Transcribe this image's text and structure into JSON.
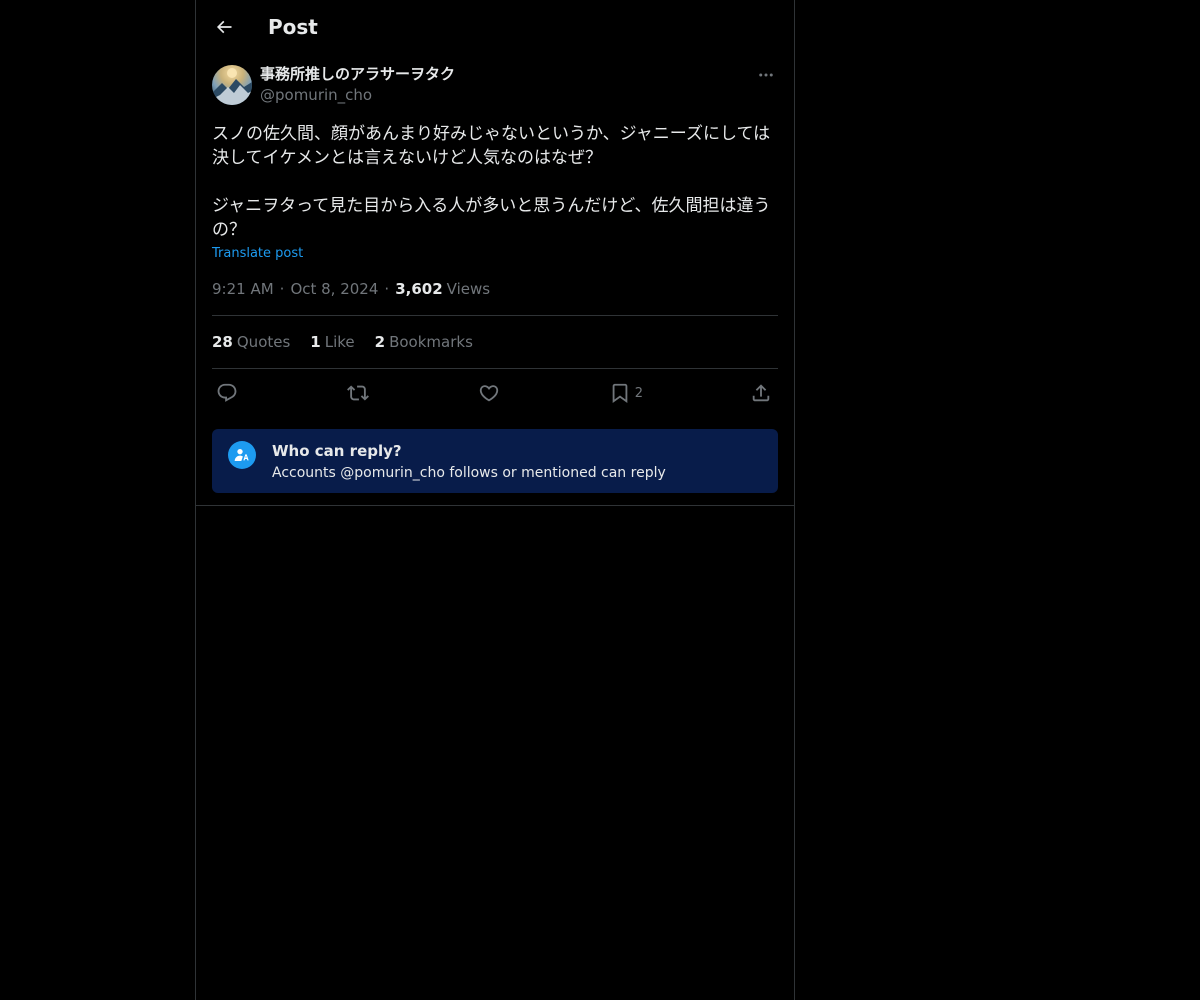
{
  "header": {
    "title": "Post"
  },
  "post": {
    "author": {
      "display_name": "事務所推しのアラサーヲタク",
      "handle": "@pomurin_cho"
    },
    "text": "スノの佐久間、顔があんまり好みじゃないというか、ジャニーズにしては決してイケメンとは言えないけど人気なのはなぜ？\n\nジャニヲタって見た目から入る人が多いと思うんだけど、佐久間担は違うの？",
    "translate_label": "Translate post",
    "time": "9:21 AM",
    "date": "Oct 8, 2024",
    "views_count": "3,602",
    "views_label": "Views",
    "separator": "·"
  },
  "stats": {
    "quotes_count": "28",
    "quotes_label": "Quotes",
    "likes_count": "1",
    "likes_label": "Like",
    "bookmarks_count": "2",
    "bookmarks_label": "Bookmarks"
  },
  "actions": {
    "reply_icon": "reply-icon",
    "repost_icon": "repost-icon",
    "like_icon": "heart-icon",
    "bookmark_icon": "bookmark-icon",
    "bookmark_count": "2",
    "share_icon": "share-icon"
  },
  "reply_restriction": {
    "title": "Who can reply?",
    "description": "Accounts @pomurin_cho follows or mentioned can reply"
  },
  "colors": {
    "background": "#000000",
    "text_primary": "#e7e9ea",
    "text_secondary": "#71767b",
    "accent": "#1d9bf0",
    "border": "#2f3336",
    "reply_box_bg": "#081c4a"
  }
}
